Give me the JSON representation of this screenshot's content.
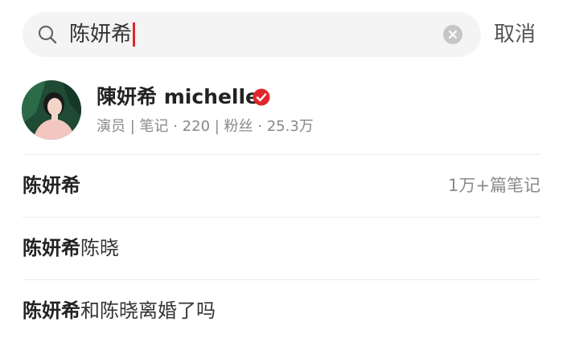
{
  "search": {
    "query": "陈妍希",
    "cancel_label": "取消"
  },
  "user_result": {
    "name": "陳妍希 michelle",
    "meta": "演员 | 笔记 · 220 | 粉丝 · 25.3万",
    "verified": true
  },
  "suggestions": [
    {
      "highlight": "陈妍希",
      "rest": "",
      "count": "1万+篇笔记"
    },
    {
      "highlight": "陈妍希",
      "rest": "陈晓",
      "count": ""
    },
    {
      "highlight": "陈妍希",
      "rest": "和陈晓离婚了吗",
      "count": ""
    }
  ],
  "colors": {
    "accent_red": "#e0262d",
    "search_bg": "#f4f4f4",
    "muted_text": "#888888"
  },
  "icons": {
    "search": "search-icon",
    "clear": "clear-icon",
    "verified": "verified-icon"
  }
}
